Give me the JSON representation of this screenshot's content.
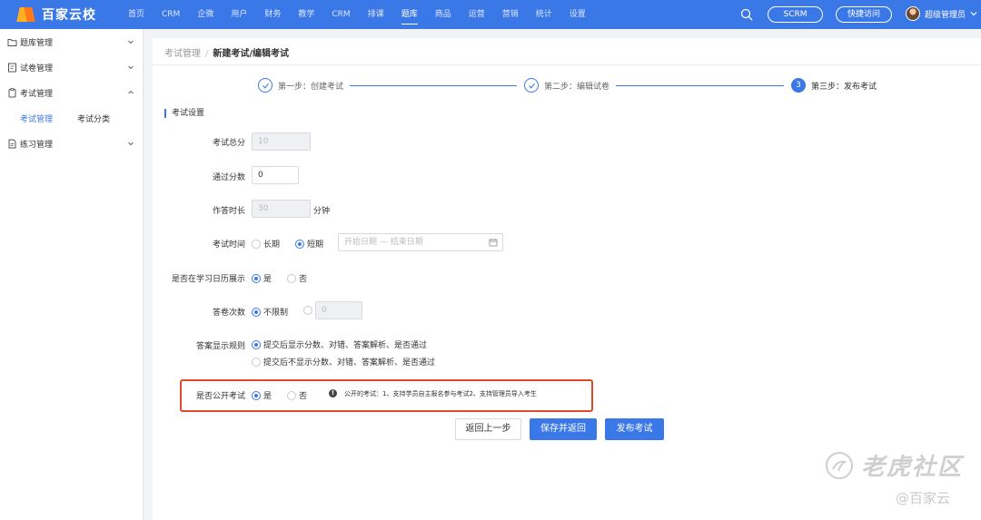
{
  "brand": {
    "name": "百家云校"
  },
  "topnav": {
    "items": [
      "首页",
      "CRM",
      "企微",
      "用户",
      "财务",
      "教学",
      "CRM",
      "排课",
      "题库",
      "商品",
      "运营",
      "营销",
      "统计",
      "设置"
    ],
    "active": "题库",
    "search_icon": "search-icon",
    "scrm_label": "SCRM",
    "quick_access_label": "快捷访问",
    "user_name": "超级管理员"
  },
  "sidebar": {
    "items": [
      {
        "label": "题库管理",
        "icon": "folder-icon",
        "expanded": false
      },
      {
        "label": "试卷管理",
        "icon": "paper-icon",
        "expanded": false
      },
      {
        "label": "考试管理",
        "icon": "exam-icon",
        "expanded": true
      },
      {
        "label": "练习管理",
        "icon": "practice-icon",
        "expanded": false
      }
    ],
    "sub_items": [
      {
        "label": "考试管理",
        "active": true
      },
      {
        "label": "考试分类",
        "active": false
      }
    ]
  },
  "breadcrumb": {
    "parent": "考试管理",
    "separator": "/",
    "current": "新建考试/编辑考试"
  },
  "steps": [
    {
      "label": "第一步：创建考试",
      "status": "done"
    },
    {
      "label": "第二步：编辑试卷",
      "status": "done"
    },
    {
      "number": "3",
      "label": "第三步：发布考试",
      "status": "current"
    }
  ],
  "section_title": "考试设置",
  "form": {
    "total_score": {
      "label": "考试总分",
      "value": "10"
    },
    "pass_score": {
      "label": "通过分数",
      "value": "0"
    },
    "duration": {
      "label": "作答时长",
      "value": "30",
      "unit": "分钟"
    },
    "exam_time": {
      "label": "考试时间",
      "options": [
        "长期",
        "短期"
      ],
      "selected": "短期",
      "range_placeholder": "开始日期 — 结束日期"
    },
    "calendar_show": {
      "label": "是否在学习日历展示",
      "options": [
        "是",
        "否"
      ],
      "selected": "是"
    },
    "attempts": {
      "label": "答卷次数",
      "options": [
        "不限制"
      ],
      "selected": "不限制",
      "limit_value": "0"
    },
    "answer_rule": {
      "label": "答案显示规则",
      "options": [
        "提交后显示分数、对错、答案解析、是否通过",
        "提交后不显示分数、对错、答案解析、是否通过"
      ],
      "selected": "提交后显示分数、对错、答案解析、是否通过"
    },
    "public_exam": {
      "label": "是否公开考试",
      "options": [
        "是",
        "否"
      ],
      "selected": "是",
      "note": "公开的考试：1、支持学员自主报名参与考试2、支持管理员导入考生"
    }
  },
  "buttons": {
    "back": "返回上一步",
    "save_return": "保存并返回",
    "publish": "发布考试"
  },
  "watermark": {
    "line1": "老虎社区",
    "line2": "@百家云"
  },
  "colors": {
    "primary": "#3b78e7",
    "highlight": "#e0492b"
  }
}
